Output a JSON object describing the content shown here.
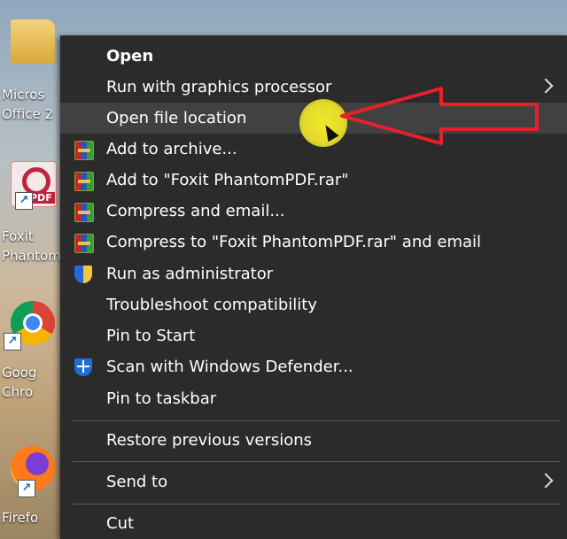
{
  "desktop": {
    "icons": [
      {
        "label": "Micros\nOffice 2",
        "icon": "folder-icon"
      },
      {
        "label": "Foxit\nPhantom",
        "icon": "foxit-icon",
        "badge": "PDF"
      },
      {
        "label": "Goog\nChro",
        "icon": "chrome-icon"
      },
      {
        "label": "Firefo",
        "icon": "firefox-icon"
      }
    ]
  },
  "menu": {
    "items": [
      {
        "label": "Open",
        "bold": true
      },
      {
        "label": "Run with graphics processor",
        "submenu": true
      },
      {
        "label": "Open file location",
        "hover": true
      },
      {
        "label": "Add to archive...",
        "icon": "winrar-icon"
      },
      {
        "label": "Add to \"Foxit PhantomPDF.rar\"",
        "icon": "winrar-icon"
      },
      {
        "label": "Compress and email...",
        "icon": "winrar-icon"
      },
      {
        "label": "Compress to \"Foxit PhantomPDF.rar\" and email",
        "icon": "winrar-icon"
      },
      {
        "label": "Run as administrator",
        "icon": "uac-shield-icon"
      },
      {
        "label": "Troubleshoot compatibility"
      },
      {
        "label": "Pin to Start"
      },
      {
        "label": "Scan with Windows Defender...",
        "icon": "windows-defender-icon"
      },
      {
        "label": "Pin to taskbar"
      },
      {
        "label": "Restore previous versions"
      },
      {
        "label": "Send to",
        "submenu": true
      },
      {
        "label": "Cut"
      }
    ]
  },
  "colors": {
    "menu_bg": "#2b2b2b",
    "hover_bg": "#414141",
    "annotation_red": "#e8202a",
    "highlight_yellow": "#e3d92a"
  }
}
